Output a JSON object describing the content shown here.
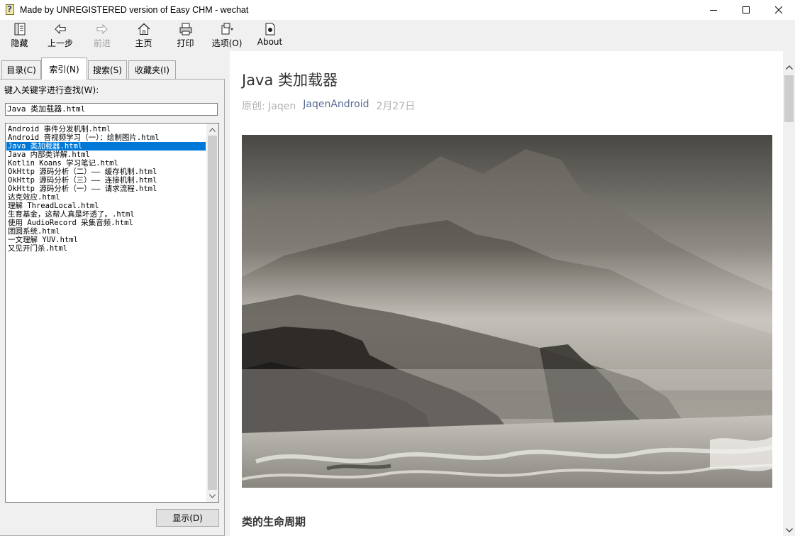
{
  "window": {
    "title": "Made by UNREGISTERED version of Easy CHM - wechat"
  },
  "toolbar": {
    "buttons": [
      {
        "label": "隐藏",
        "icon": "hide-icon",
        "enabled": true
      },
      {
        "label": "上一步",
        "icon": "back-arrow-icon",
        "enabled": true
      },
      {
        "label": "前进",
        "icon": "forward-arrow-icon",
        "enabled": false
      },
      {
        "label": "主页",
        "icon": "home-icon",
        "enabled": true
      },
      {
        "label": "打印",
        "icon": "printer-icon",
        "enabled": true
      },
      {
        "label": "选项(O)",
        "icon": "options-icon",
        "enabled": true
      },
      {
        "label": "About",
        "icon": "about-icon",
        "enabled": true
      }
    ]
  },
  "tabs": [
    {
      "label": "目录(C)"
    },
    {
      "label": "索引(N)",
      "active": true
    },
    {
      "label": "搜索(S)"
    },
    {
      "label": "收藏夹(I)"
    }
  ],
  "index": {
    "keyword_label": "键入关键字进行查找(W):",
    "keyword_value": "Java 类加载器.html",
    "items": [
      "Android 事件分发机制.html",
      "Android 音视频学习（一）：绘制图片.html",
      "Java 类加载器.html",
      "Java 内部类详解.html",
      "Kotlin Koans 学习笔记.html",
      "OkHttp 源码分析（二）—— 缓存机制.html",
      "OkHttp 源码分析（三）—— 连接机制.html",
      "OkHttp 源码分析（一）—— 请求流程.html",
      "达克效应.html",
      "理解 ThreadLocal.html",
      "生育基金，这帮人真是坏透了。.html",
      "使用 AudioRecord 采集音频.html",
      "团圆系统.html",
      "一文理解 YUV.html",
      "又见开门杀.html"
    ],
    "selected_index": 2,
    "show_button": "显示(D)"
  },
  "article": {
    "title": "Java 类加载器",
    "original": "原创:",
    "author": "Jaqen",
    "account": "JaqenAndroid",
    "date": "2月27日",
    "section_heading": "类的生命周期"
  }
}
